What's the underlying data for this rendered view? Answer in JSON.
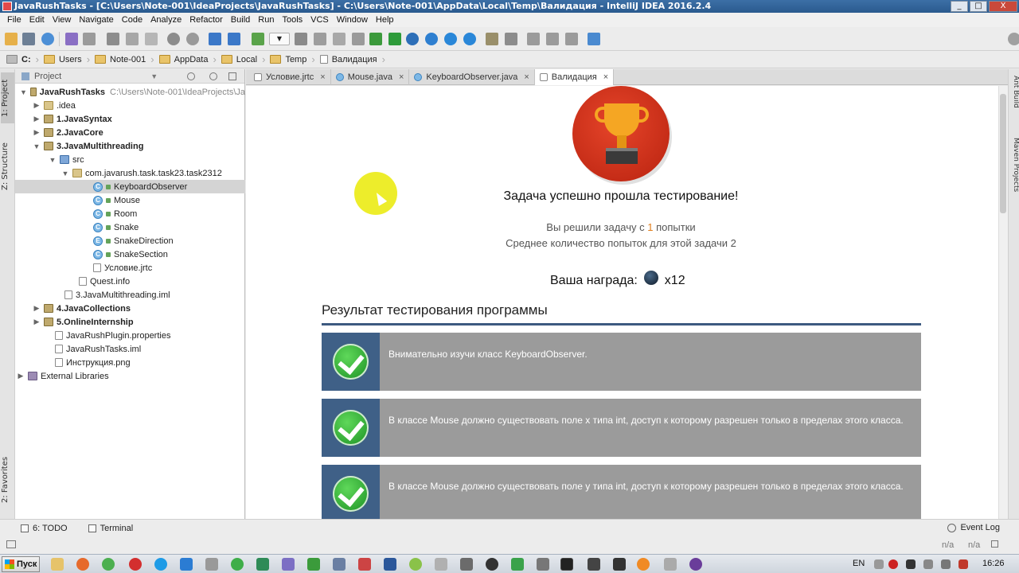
{
  "window": {
    "title": "JavaRushTasks - [C:\\Users\\Note-001\\IdeaProjects\\JavaRushTasks] - C:\\Users\\Note-001\\AppData\\Local\\Temp\\Валидация - IntelliJ IDEA 2016.2.4",
    "minimize": "_",
    "maximize": "□",
    "close": "X"
  },
  "menu": [
    "File",
    "Edit",
    "View",
    "Navigate",
    "Code",
    "Analyze",
    "Refactor",
    "Build",
    "Run",
    "Tools",
    "VCS",
    "Window",
    "Help"
  ],
  "breadcrumb": [
    "C:",
    "Users",
    "Note-001",
    "AppData",
    "Local",
    "Temp",
    "Валидация"
  ],
  "sidebar_left": {
    "project_tab": "1: Project",
    "structure_tab": "Z: Structure",
    "favorites_tab": "2: Favorites"
  },
  "sidebar_right": {
    "ant_tab": "Ant Build",
    "maven_tab": "Maven Projects"
  },
  "project_panel": {
    "header": "Project",
    "tree": [
      {
        "label": "JavaRushTasks",
        "path": "C:\\Users\\Note-001\\IdeaProjects\\Ja"
      },
      {
        "label": ".idea"
      },
      {
        "label": "1.JavaSyntax"
      },
      {
        "label": "2.JavaCore"
      },
      {
        "label": "3.JavaMultithreading"
      },
      {
        "label": "src"
      },
      {
        "label": "com.javarush.task.task23.task2312"
      },
      {
        "label": "KeyboardObserver"
      },
      {
        "label": "Mouse"
      },
      {
        "label": "Room"
      },
      {
        "label": "Snake"
      },
      {
        "label": "SnakeDirection"
      },
      {
        "label": "SnakeSection"
      },
      {
        "label": "Условие.jrtc"
      },
      {
        "label": "Quest.info"
      },
      {
        "label": "3.JavaMultithreading.iml"
      },
      {
        "label": "4.JavaCollections"
      },
      {
        "label": "5.OnlineInternship"
      },
      {
        "label": "JavaRushPlugin.properties"
      },
      {
        "label": "JavaRushTasks.iml"
      },
      {
        "label": "Инструкция.png"
      },
      {
        "label": "External Libraries"
      }
    ]
  },
  "tabs": [
    {
      "label": "Условие.jrtc",
      "close": "×"
    },
    {
      "label": "Mouse.java",
      "close": "×"
    },
    {
      "label": "KeyboardObserver.java",
      "close": "×"
    },
    {
      "label": "Валидация",
      "close": "×"
    }
  ],
  "validation": {
    "success_title": "Задача успешно прошла тестирование!",
    "attempts_prefix": "Вы решили задачу с",
    "attempts_value": "1",
    "attempts_suffix": "попытки",
    "avg_text": "Среднее количество попыток для этой задачи 2",
    "reward_label": "Ваша награда:",
    "reward_value": "x12",
    "results_title": "Результат тестирования программы",
    "results": [
      {
        "text": "Внимательно изучи класс KeyboardObserver."
      },
      {
        "text": "В классе Mouse должно существовать поле x типа int, доступ к которому разрешен только в пределах этого класса."
      },
      {
        "text": "В классе Mouse должно существовать поле y типа int, доступ к которому разрешен только в пределах этого класса."
      }
    ]
  },
  "bottom_tools": {
    "todo": "6: TODO",
    "terminal": "Terminal",
    "event_log": "Event Log"
  },
  "status": {
    "na1": "n/a",
    "na2": "n/a"
  },
  "taskbar": {
    "start": "Пуск",
    "lang": "EN",
    "time": "16:26"
  },
  "colors": {
    "card_bg": "#9b9b9b",
    "card_mark": "#3f6087",
    "accent_line": "#3d5a80",
    "trophy_red": "#d63a1f",
    "attempt_num": "#e07c1a"
  }
}
